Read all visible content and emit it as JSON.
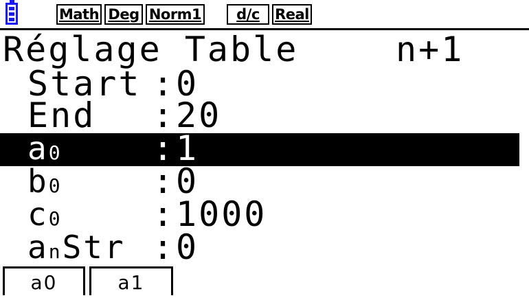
{
  "status_bar": {
    "icons": [
      "battery-icon"
    ],
    "battery_color": "#1a1aff",
    "tags": [
      "Math",
      "Deg",
      "Norm1",
      "d/c",
      "Real"
    ]
  },
  "header": {
    "title": "Réglage Table",
    "mode": "n+1"
  },
  "settings": [
    {
      "label": "Start",
      "value": "0"
    },
    {
      "label": "End",
      "value": "20"
    },
    {
      "label_main": "a",
      "label_sub": "0",
      "value": "1",
      "selected": true
    },
    {
      "label_main": "b",
      "label_sub": "0",
      "value": "0"
    },
    {
      "label_main": "c",
      "label_sub": "0",
      "value": "1000"
    },
    {
      "label_main": "a",
      "label_sub": "n",
      "label_rest": "Str",
      "value": "0"
    }
  ],
  "function_keys": [
    "a0",
    "a1"
  ],
  "colon": ":"
}
